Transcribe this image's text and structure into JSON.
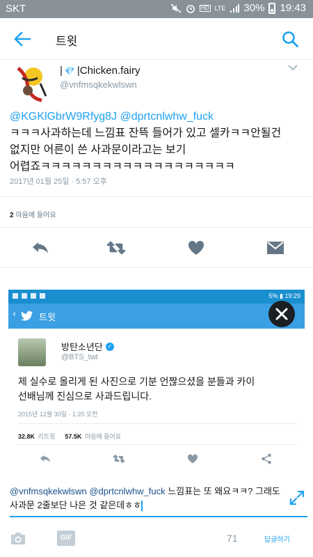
{
  "status_bar": {
    "carrier": "SKT",
    "network": "LTE",
    "battery": "30%",
    "time": "19:43"
  },
  "header": {
    "title": "트윗"
  },
  "tweet": {
    "author_name": "|Chicken.fairy",
    "author_handle": "@vnfmsqkekwlswn",
    "mention_1": "@KGKlGbrW9Rfyg8J",
    "mention_2": "@dprtcnlwhw_fuck",
    "text_line_1": "ㅋㅋㅋ사과하는데 느낌표 잔뜩 들어가 있고 셀카ㅋㅋ안될건",
    "text_line_2": "없지만 어른이 쓴 사과문이라고는 보기",
    "text_line_3": "어렵죠ㅋㅋㅋㅋㅋㅋㅋㅋㅋㅋㅋㅋㅋㅋㅋㅋㅋㅋㅋ",
    "timestamp": "2017년 01월 25일 · 5:57 오후",
    "likes_count": "2",
    "likes_label": "마음에 들어요"
  },
  "embedded_image": {
    "status_time": "19:29",
    "status_battery": "5%",
    "title": "트윗",
    "author_name": "방탄소년단",
    "author_handle": "@BTS_twt",
    "text_line_1": "제 실수로 올리게 된 사진으로 기분 언짢으셨을 분들과 카이",
    "text_line_2": "선배님께 진심으로 사과드립니다.",
    "timestamp": "2015년 12월 30일 · 1:20 오전",
    "retweets_count": "32.8K",
    "retweets_label": "리트윗",
    "likes_count": "57.5K",
    "likes_label": "마음에 들어요"
  },
  "reply": {
    "mention_1": "@vnfmsqkekwlswn",
    "mention_2": "@dprtcnlwhw_fuck",
    "text_line_1": "느낌표는 또 왜요ㅋㅋ? 그래도",
    "text_line_2": "사과문 2줄보단 나은 것 같은데ㅎㅎ",
    "char_count": "71",
    "reply_button_label": "답글하기"
  },
  "colors": {
    "accent": "#1da1f2",
    "status_bar": "#8a9299",
    "secondary_text": "#8899a6",
    "action_icon": "#657786"
  }
}
